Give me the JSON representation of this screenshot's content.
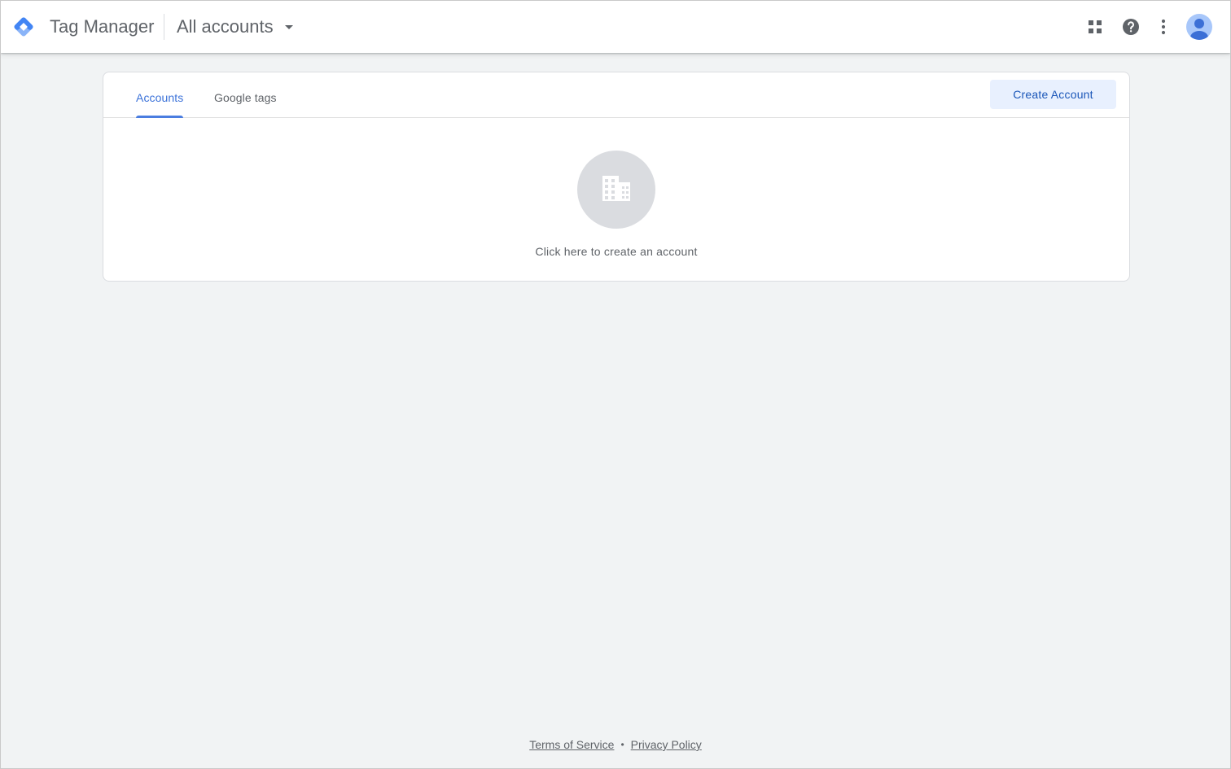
{
  "header": {
    "product_name": "Tag Manager",
    "account_selector_label": "All accounts",
    "icons": {
      "apps": "apps-grid-icon",
      "help": "help-icon",
      "more": "more-vert-icon",
      "avatar": "account-avatar"
    }
  },
  "tabs": [
    {
      "label": "Accounts",
      "active": true
    },
    {
      "label": "Google tags",
      "active": false
    }
  ],
  "actions": {
    "create_account_label": "Create Account"
  },
  "empty_state": {
    "icon": "building-icon",
    "text": "Click here to create an account"
  },
  "footer": {
    "terms_label": "Terms of Service",
    "separator": "•",
    "privacy_label": "Privacy Policy"
  },
  "colors": {
    "accent": "#3b72d9",
    "background": "#f1f3f4",
    "button_bg": "#e8f0fe",
    "text_secondary": "#5f6368"
  }
}
